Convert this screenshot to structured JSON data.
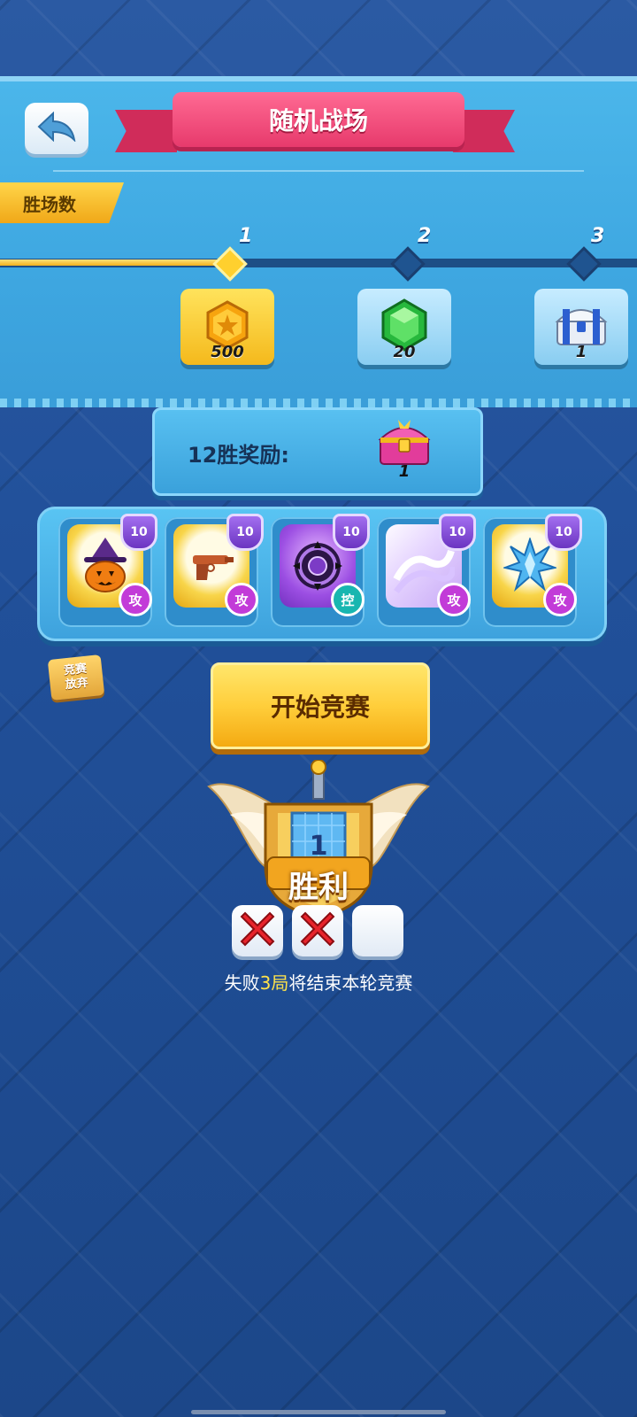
{
  "header": {
    "title": "随机战场",
    "back_icon": "back-arrow-icon"
  },
  "wins_track": {
    "label": "胜场数",
    "current_progress": 1,
    "milestones": [
      {
        "number": "1",
        "reward_icon": "gold-coin-icon",
        "reward_qty": "500",
        "reached": true
      },
      {
        "number": "2",
        "reward_icon": "green-gem-icon",
        "reward_qty": "20",
        "reached": false
      },
      {
        "number": "3",
        "reward_icon": "blue-chest-icon",
        "reward_qty": "1",
        "reached": false
      }
    ]
  },
  "win12_reward": {
    "label": "12胜奖励:",
    "reward_icon": "treasure-chest-icon",
    "reward_qty": "1"
  },
  "skills": [
    {
      "icon": "pumpkin-witch-icon",
      "level": "10",
      "type": "攻"
    },
    {
      "icon": "pistol-icon",
      "level": "10",
      "type": "攻"
    },
    {
      "icon": "purple-vortex-icon",
      "level": "10",
      "type": "控"
    },
    {
      "icon": "white-wave-icon",
      "level": "10",
      "type": "攻"
    },
    {
      "icon": "ice-crystal-icon",
      "level": "10",
      "type": "攻"
    }
  ],
  "abandon_button": {
    "line1": "竞赛",
    "line2": "放弃"
  },
  "start_button": {
    "label": "开始竞赛"
  },
  "victory": {
    "count": "1",
    "label": "胜利"
  },
  "losses": {
    "slots": [
      "lost",
      "lost",
      "empty"
    ],
    "note_prefix": "失败",
    "note_highlight": "3局",
    "note_suffix": "将结束本轮竞赛"
  },
  "colors": {
    "panel_blue": "#3ea7e1",
    "title_pink": "#e73a6c",
    "gold": "#f4b91c",
    "background_blue": "#21509a"
  }
}
